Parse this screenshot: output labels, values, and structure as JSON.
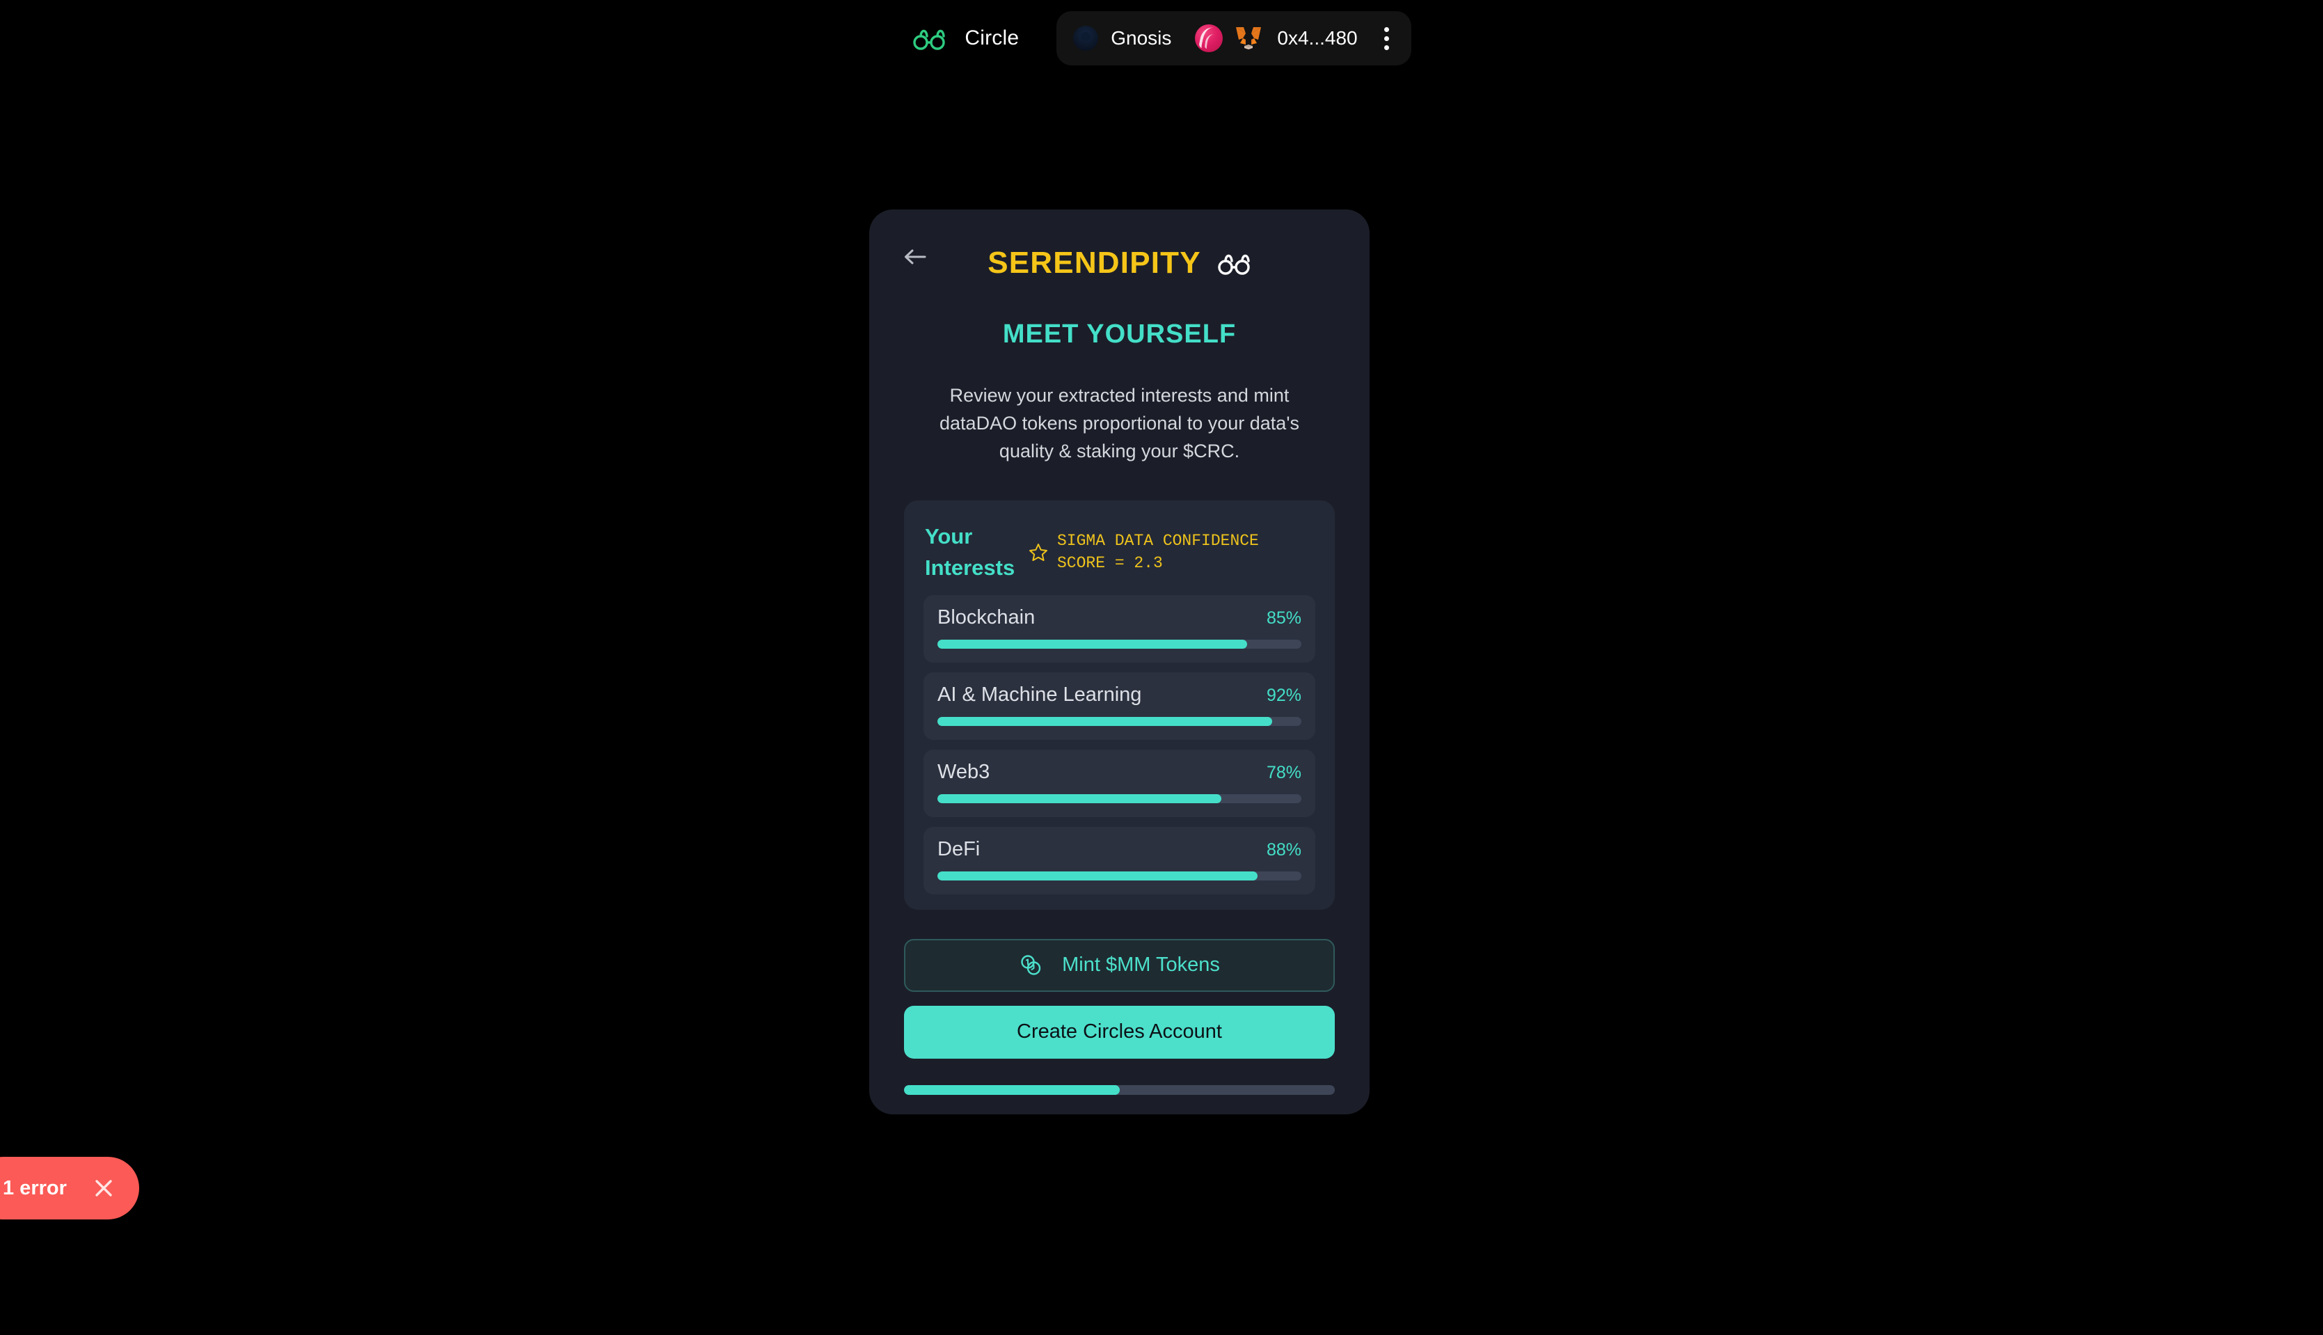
{
  "nav": {
    "logo_icon": "glasses-icon",
    "brand_name": "Circle",
    "chain_icon": "gnosis-chain-icon",
    "chain_name": "Gnosis",
    "avatar_icon": "account-avatar",
    "wallet_icon": "metamask-fox-icon",
    "address": "0x4...480",
    "menu_icon": "kebab-menu-icon"
  },
  "card": {
    "back_icon": "arrow-left-icon",
    "title": "SERENDIPITY",
    "title_icon": "glasses-icon",
    "subtitle": "MEET YOURSELF",
    "description": "Review your extracted interests and mint dataDAO tokens proportional to your data's quality & staking your $CRC.",
    "interests": {
      "heading": "Your Interests",
      "score_icon": "star-icon",
      "score_text": "SIGMA DATA CONFIDENCE\nSCORE = 2.3",
      "items": [
        {
          "label": "Blockchain",
          "percent_label": "85%",
          "percent": 85
        },
        {
          "label": "AI & Machine Learning",
          "percent_label": "92%",
          "percent": 92
        },
        {
          "label": "Web3",
          "percent_label": "78%",
          "percent": 78
        },
        {
          "label": "DeFi",
          "percent_label": "88%",
          "percent": 88
        }
      ]
    },
    "mint_button": {
      "icon": "coins-icon",
      "label": "Mint $MM Tokens"
    },
    "create_button": {
      "label": "Create Circles Account"
    },
    "footer_progress": {
      "percent": 50
    }
  },
  "error_toast": {
    "label": "1 error",
    "close_icon": "close-icon"
  },
  "colors": {
    "page_bg": "#000000",
    "card_bg": "#1b1e29",
    "panel_bg": "#242937",
    "row_bg": "#2b313f",
    "accent_teal": "#45dfc9",
    "accent_gold": "#f5c518",
    "brand_green": "#2ecc80",
    "error_red": "#fb5a56",
    "track": "#3d4557"
  }
}
